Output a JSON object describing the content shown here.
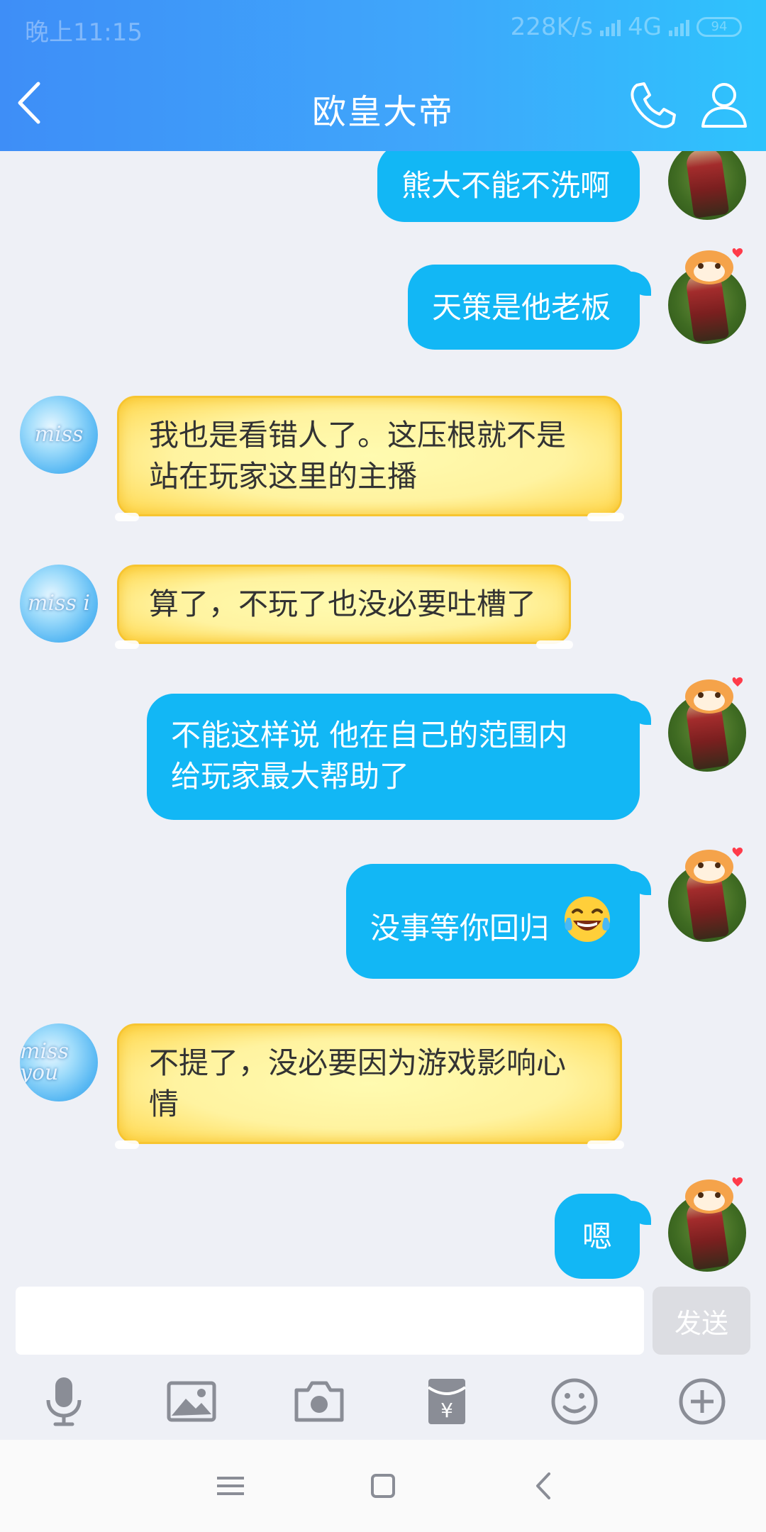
{
  "status_bar": {
    "time": "晚上11:15",
    "speed": "228K/s",
    "network": "4G",
    "battery": "94"
  },
  "header": {
    "title": "欧皇大帝",
    "back_icon": "chevron-left-icon",
    "phone_icon": "phone-icon",
    "profile_icon": "person-icon"
  },
  "messages": [
    {
      "side": "out",
      "text": "熊大不能不洗啊"
    },
    {
      "side": "out",
      "text": "天策是他老板"
    },
    {
      "side": "in",
      "line1": "我也是看错人了。这压根就不是",
      "line2": "站在玩家这里的主播",
      "avatar_text": "miss"
    },
    {
      "side": "in",
      "text": "算了，不玩了也没必要吐槽了",
      "avatar_text": "miss i"
    },
    {
      "side": "out",
      "line1": "不能这样说  他在自己的范围内",
      "line2": "给玩家最大帮助了"
    },
    {
      "side": "out",
      "text": "没事等你回归",
      "emoji": "tears-of-joy-emoji"
    },
    {
      "side": "in",
      "line1": "不提了，没必要因为游戏影响心",
      "line2": "情",
      "avatar_text": "miss you"
    },
    {
      "side": "out",
      "text": "嗯"
    }
  ],
  "composer": {
    "input_value": "",
    "send_label": "发送"
  },
  "toolbar": {
    "items": [
      "microphone-icon",
      "image-icon",
      "camera-icon",
      "red-packet-icon",
      "emoji-icon",
      "plus-icon"
    ]
  },
  "nav": {
    "items": [
      "menu-icon",
      "home-square-icon",
      "back-icon"
    ]
  },
  "colors": {
    "header_start": "#3e8ef7",
    "header_end": "#2ec3fc",
    "bubble_out": "#12b7f5",
    "bubble_in": "#fff3a0",
    "background": "#eef0f6"
  }
}
